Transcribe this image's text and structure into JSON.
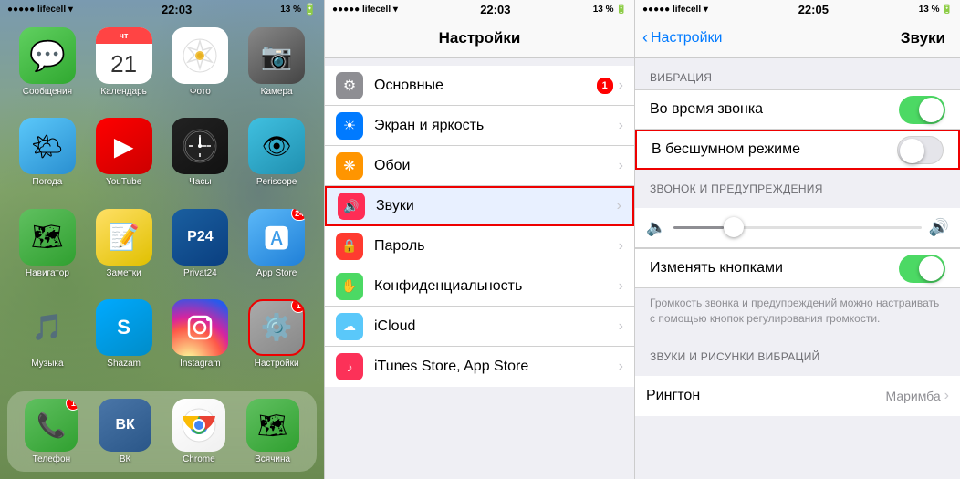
{
  "panel1": {
    "status": {
      "carrier": "●●●●● lifecell",
      "wifi": "▲",
      "time": "22:03",
      "battery": "13 %"
    },
    "apps_row1": [
      {
        "id": "messages",
        "label": "Сообщения",
        "icon_class": "ic-messages",
        "badge": null
      },
      {
        "id": "calendar",
        "label": "Календарь",
        "icon_class": "ic-calendar",
        "badge": null,
        "cal_day": "чт",
        "cal_num": "21"
      },
      {
        "id": "photos",
        "label": "Фото",
        "icon_class": "ic-photos",
        "badge": null
      },
      {
        "id": "camera",
        "label": "Камера",
        "icon_class": "ic-camera",
        "badge": null
      }
    ],
    "apps_row2": [
      {
        "id": "weather",
        "label": "Погода",
        "icon_class": "ic-weather",
        "badge": null
      },
      {
        "id": "youtube",
        "label": "YouTube",
        "icon_class": "ic-youtube",
        "badge": null
      },
      {
        "id": "clock",
        "label": "Часы",
        "icon_class": "ic-clock",
        "badge": null
      },
      {
        "id": "periscope",
        "label": "Periscope",
        "icon_class": "ic-periscope",
        "badge": null
      }
    ],
    "apps_row3": [
      {
        "id": "maps",
        "label": "Навигатор",
        "icon_class": "ic-maps",
        "badge": null
      },
      {
        "id": "notes",
        "label": "Заметки",
        "icon_class": "ic-notes",
        "badge": null
      },
      {
        "id": "privat24",
        "label": "Privat24",
        "icon_class": "ic-privat",
        "badge": null
      },
      {
        "id": "appstore",
        "label": "App Store",
        "icon_class": "ic-appstore",
        "badge": null,
        "badge_num": "24"
      }
    ],
    "apps_row4": [
      {
        "id": "music",
        "label": "Музыка",
        "icon_class": "ic-music",
        "badge": null
      },
      {
        "id": "shazam",
        "label": "Shazam",
        "icon_class": "ic-shazam",
        "badge": null
      },
      {
        "id": "instagram",
        "label": "Instagram",
        "icon_class": "ic-instagram",
        "badge": null
      },
      {
        "id": "settings",
        "label": "Настройки",
        "icon_class": "ic-settings",
        "badge": "1",
        "highlighted": true
      }
    ],
    "dock": [
      {
        "id": "phone",
        "label": "Телефон",
        "icon_class": "ic-phone",
        "badge": "1"
      },
      {
        "id": "vk",
        "label": "ВК",
        "icon_class": "ic-vk",
        "badge": null
      },
      {
        "id": "chrome",
        "label": "Chrome",
        "icon_class": "ic-chrome",
        "badge": null
      },
      {
        "id": "maps2",
        "label": "Всячина",
        "icon_class": "ic-maps2",
        "badge": null
      }
    ]
  },
  "panel2": {
    "status": {
      "carrier": "●●●●● lifecell",
      "time": "22:03",
      "battery": "13 %"
    },
    "title": "Настройки",
    "items": [
      {
        "id": "general",
        "label": "Основные",
        "icon_class": "s-icon-gray",
        "icon": "⚙",
        "badge": "1"
      },
      {
        "id": "display",
        "label": "Экран и яркость",
        "icon_class": "s-icon-blue",
        "icon": "☀",
        "badge": null
      },
      {
        "id": "wallpaper",
        "label": "Обои",
        "icon_class": "s-icon-orange",
        "icon": "❋",
        "badge": null
      },
      {
        "id": "sounds",
        "label": "Звуки",
        "icon_class": "s-icon-sound",
        "icon": "🔊",
        "badge": null,
        "highlighted": true
      },
      {
        "id": "password",
        "label": "Пароль",
        "icon_class": "s-icon-red",
        "icon": "🔒",
        "badge": null
      },
      {
        "id": "privacy",
        "label": "Конфиденциальность",
        "icon_class": "s-icon-privacy",
        "icon": "✋",
        "badge": null
      },
      {
        "id": "icloud",
        "label": "iCloud",
        "icon_class": "s-icon-icloud",
        "icon": "☁",
        "badge": null
      },
      {
        "id": "itunes",
        "label": "iTunes Store, App Store",
        "icon_class": "s-icon-itunes",
        "icon": "♪",
        "badge": null
      }
    ]
  },
  "panel3": {
    "status": {
      "carrier": "●●●●● lifecell",
      "time": "22:05",
      "battery": "13 %"
    },
    "back_label": "Настройки",
    "title": "Звуки",
    "section_vibration": "ВИБРАЦИЯ",
    "vibration_on_label": "Во время звонка",
    "vibration_on_value": true,
    "vibration_silent_label": "В бесшумном режиме",
    "vibration_silent_value": false,
    "section_ringtone": "ЗВОНОК И ПРЕДУПРЕЖДЕНИЯ",
    "change_buttons_label": "Изменять кнопками",
    "change_buttons_value": true,
    "description": "Громкость звонка и предупреждений можно настраивать с помощью кнопок регулирования громкости.",
    "section_sounds": "ЗВУКИ И РИСУНКИ ВИБРАЦИЙ",
    "ringtone_label": "Рингтон",
    "ringtone_value": "Маримба"
  }
}
